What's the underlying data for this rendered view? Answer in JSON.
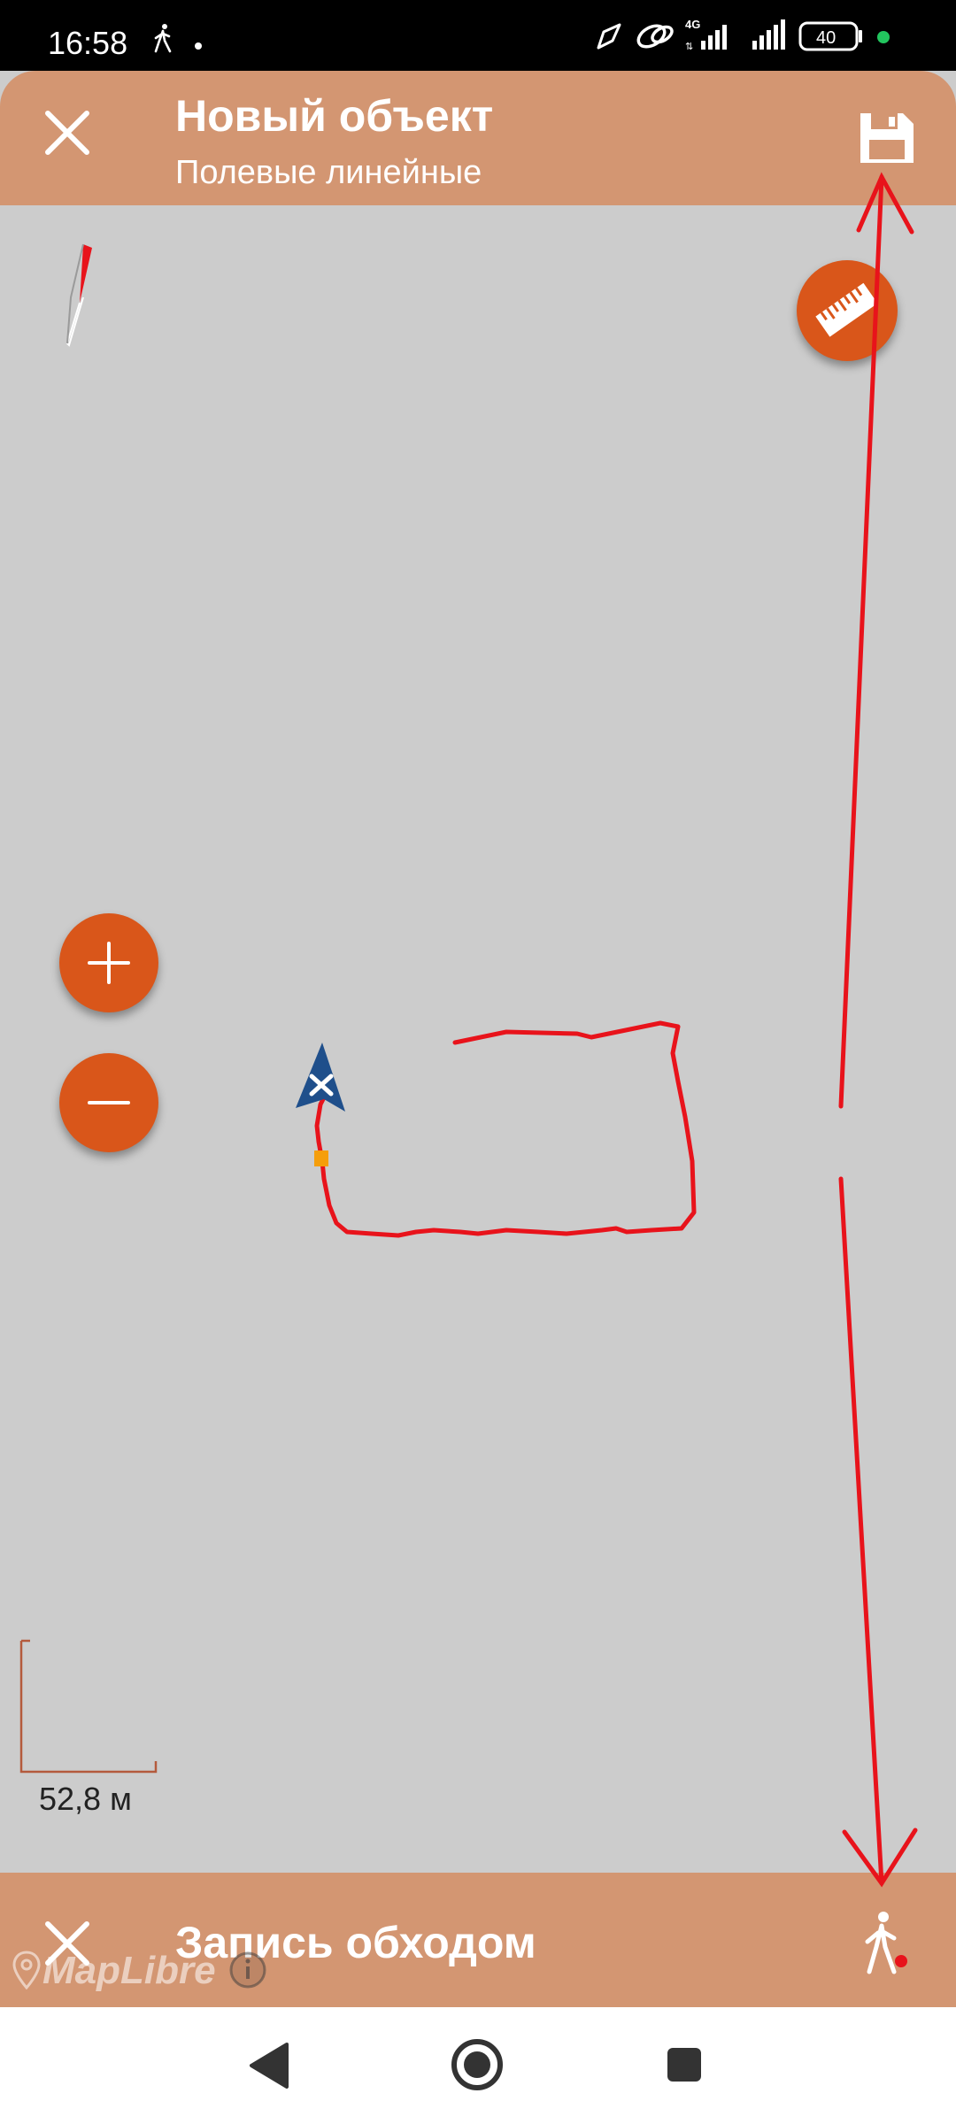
{
  "status_bar": {
    "time": "16:58",
    "network": "4G",
    "battery": "40"
  },
  "app_bar": {
    "title": "Новый объект",
    "subtitle": "Полевые линейные",
    "close_icon": "close-icon",
    "save_icon": "save-floppy-icon"
  },
  "map": {
    "ruler_icon": "ruler-icon",
    "zoom_in_icon": "plus-icon",
    "zoom_out_icon": "minus-icon",
    "scale_label": "52,8 м",
    "track_color": "#e8131b",
    "marker_color": "#1f4f8b"
  },
  "bottom_bar": {
    "title": "Запись обходом",
    "close_icon": "close-icon",
    "walk_icon": "walk-record-icon",
    "attribution": "MapLibre"
  },
  "colors": {
    "accent": "#d9561a",
    "bar": "#d39672",
    "map_background": "#cccccc",
    "annotation": "#e8131b"
  }
}
